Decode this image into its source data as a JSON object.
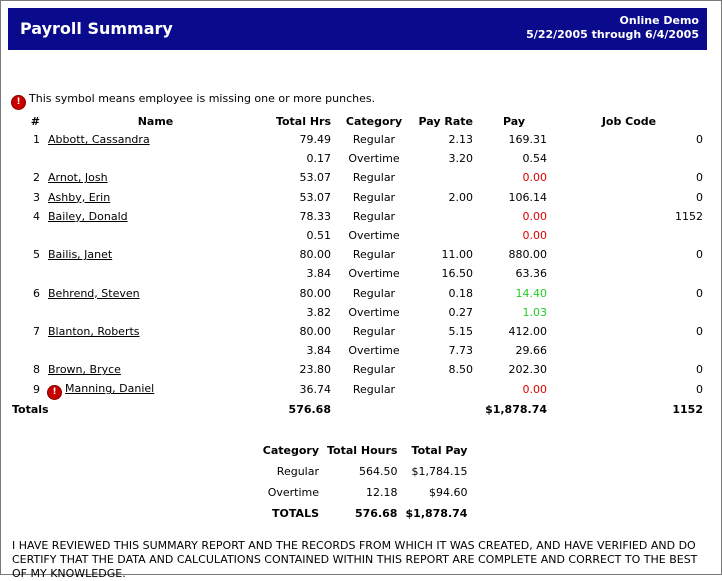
{
  "header": {
    "title": "Payroll Summary",
    "company": "Online Demo",
    "date_range": "5/22/2005 through 6/4/2005"
  },
  "note": "This symbol means employee is missing one or more punches.",
  "columns": [
    "#",
    "Name",
    "Total Hrs",
    "Category",
    "Pay Rate",
    "Pay",
    "Job Code"
  ],
  "rows": [
    {
      "num": "1",
      "name": "Abbott, Cassandra",
      "hrs": "79.49",
      "cat": "Regular",
      "rate": "2.13",
      "pay": "169.31",
      "job": "0"
    },
    {
      "num": "",
      "name": "",
      "hrs": "0.17",
      "cat": "Overtime",
      "rate": "3.20",
      "pay": "0.54",
      "job": ""
    },
    {
      "num": "2",
      "name": "Arnot, Josh",
      "hrs": "53.07",
      "cat": "Regular",
      "rate": "",
      "pay": "0.00",
      "pay_color": "red",
      "job": "0"
    },
    {
      "num": "3",
      "name": "Ashby, Erin",
      "hrs": "53.07",
      "cat": "Regular",
      "rate": "2.00",
      "pay": "106.14",
      "job": "0"
    },
    {
      "num": "4",
      "name": "Bailey, Donald",
      "hrs": "78.33",
      "cat": "Regular",
      "rate": "",
      "pay": "0.00",
      "pay_color": "red",
      "job": "1152"
    },
    {
      "num": "",
      "name": "",
      "hrs": "0.51",
      "cat": "Overtime",
      "rate": "",
      "pay": "0.00",
      "pay_color": "red",
      "job": ""
    },
    {
      "num": "5",
      "name": "Bailis, Janet",
      "hrs": "80.00",
      "cat": "Regular",
      "rate": "11.00",
      "pay": "880.00",
      "job": "0"
    },
    {
      "num": "",
      "name": "",
      "hrs": "3.84",
      "cat": "Overtime",
      "rate": "16.50",
      "pay": "63.36",
      "job": ""
    },
    {
      "num": "6",
      "name": "Behrend, Steven",
      "hrs": "80.00",
      "cat": "Regular",
      "rate": "0.18",
      "pay": "14.40",
      "pay_color": "green",
      "job": "0"
    },
    {
      "num": "",
      "name": "",
      "hrs": "3.82",
      "cat": "Overtime",
      "rate": "0.27",
      "pay": "1.03",
      "pay_color": "green",
      "job": ""
    },
    {
      "num": "7",
      "name": "Blanton, Roberts",
      "hrs": "80.00",
      "cat": "Regular",
      "rate": "5.15",
      "pay": "412.00",
      "job": "0"
    },
    {
      "num": "",
      "name": "",
      "hrs": "3.84",
      "cat": "Overtime",
      "rate": "7.73",
      "pay": "29.66",
      "job": ""
    },
    {
      "num": "8",
      "name": "Brown, Bryce",
      "hrs": "23.80",
      "cat": "Regular",
      "rate": "8.50",
      "pay": "202.30",
      "job": "0"
    },
    {
      "num": "9",
      "name": "Manning, Daniel",
      "hrs": "36.74",
      "cat": "Regular",
      "rate": "",
      "pay": "0.00",
      "pay_color": "red",
      "job": "0",
      "missing": true
    }
  ],
  "totals": {
    "label": "Totals",
    "hrs": "576.68",
    "pay": "$1,878.74",
    "job": "1152"
  },
  "summary": {
    "columns": [
      "Category",
      "Total Hours",
      "Total Pay"
    ],
    "rows": [
      {
        "cat": "Regular",
        "hrs": "564.50",
        "pay": "$1,784.15"
      },
      {
        "cat": "Overtime",
        "hrs": "12.18",
        "pay": "$94.60"
      }
    ],
    "totals": {
      "label": "TOTALS",
      "hrs": "576.68",
      "pay": "$1,878.74"
    }
  },
  "certification": "I HAVE REVIEWED THIS SUMMARY REPORT AND THE RECORDS FROM WHICH IT WAS CREATED, AND HAVE VERIFIED AND DO CERTIFY THAT THE DATA AND CALCULATIONS CONTAINED WITHIN THIS REPORT ARE COMPLETE AND CORRECT TO THE BEST OF MY KNOWLEDGE.",
  "colors": {
    "header_bg": "#0a0a8c",
    "negative": "#e00000",
    "positive": "#22cc22",
    "icon": "#c80000"
  },
  "icons": {
    "missing_punch": "exclamation-circle-icon"
  }
}
